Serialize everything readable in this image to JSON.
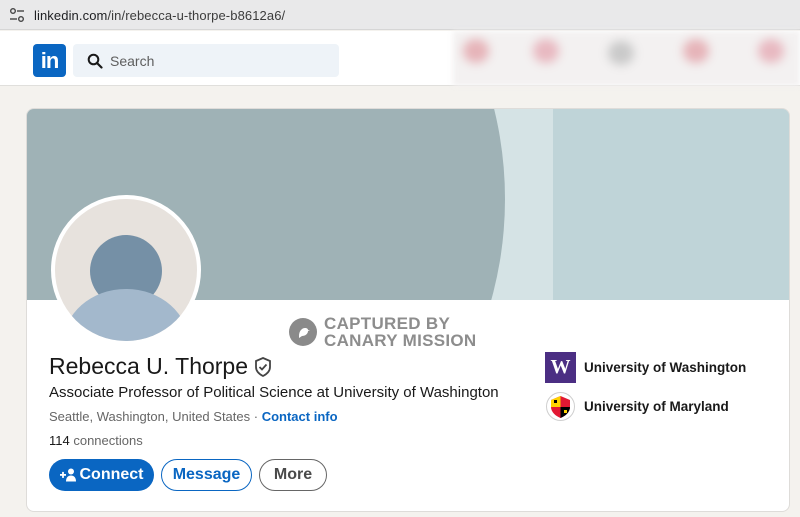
{
  "browser": {
    "url_host": "linkedin.com",
    "url_path": "/in/rebecca-u-thorpe-b8612a6/"
  },
  "nav": {
    "logo_text": "in",
    "search_placeholder": "Search"
  },
  "profile": {
    "name": "Rebecca U. Thorpe",
    "headline": "Associate Professor of Political Science at University of Washington",
    "location": "Seattle, Washington, United States",
    "separator": " · ",
    "contact_label": "Contact info",
    "connections_count": "114",
    "connections_label": " connections"
  },
  "watermark": {
    "line1": "CAPTURED BY",
    "line2": "CANARY MISSION"
  },
  "actions": {
    "connect_label": "Connect",
    "message_label": "Message",
    "more_label": "More"
  },
  "education": [
    {
      "name": "University of Washington",
      "logo_text": "W",
      "logo_color": "#4b2e83"
    },
    {
      "name": "University of Maryland"
    }
  ],
  "colors": {
    "linkedin_blue": "#0a66c2",
    "page_background": "#f4f2ee"
  }
}
